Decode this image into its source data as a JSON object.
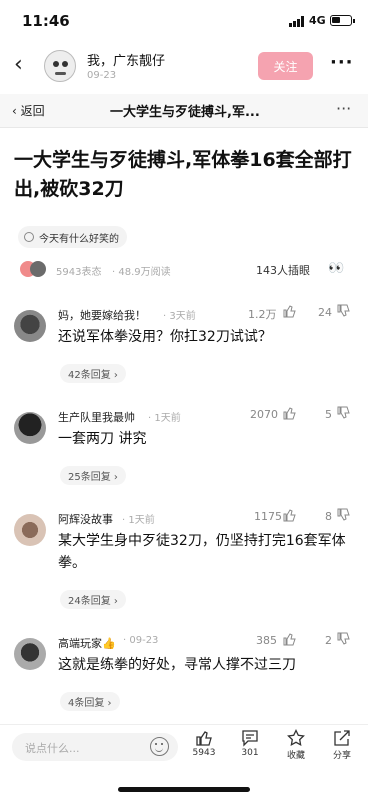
{
  "status": {
    "time": "11:46",
    "network": "4G"
  },
  "appbar": {
    "author": "我，广东靓仔",
    "date": "09-23",
    "follow": "关注"
  },
  "navbar": {
    "back": "返回",
    "title": "一大学生与歹徒搏斗,军..."
  },
  "article": {
    "headline": "一大学生与歹徒搏斗,军体拳16套全部打出,被砍32刀",
    "topic": "今天有什么好笑的",
    "reactions": "5943表态",
    "reads": "48.9万阅读",
    "inserts": "143人插眼"
  },
  "comments": [
    {
      "user": "妈，她要嫁给我！",
      "time": "3天前",
      "likes": "1.2万",
      "dislikes": "24",
      "text": "还说军体拳没用？你扛32刀试试？",
      "replies": "42条回复 ›"
    },
    {
      "user": "生产队里我最帅",
      "time": "1天前",
      "likes": "2070",
      "dislikes": "5",
      "text": "一套两刀 讲究",
      "replies": "25条回复 ›"
    },
    {
      "user": "阿辉没故事",
      "time": "1天前",
      "likes": "1175",
      "dislikes": "8",
      "text": "某大学生身中歹徒32刀，仍坚持打完16套军体拳。",
      "replies": "24条回复 ›"
    },
    {
      "user": "高端玩家👍",
      "time": "09-23",
      "likes": "385",
      "dislikes": "2",
      "text": "这就是练拳的好处，寻常人撑不过三刀",
      "replies": "4条回复 ›"
    }
  ],
  "bottom": {
    "placeholder": "说点什么...",
    "likes": "5943",
    "comments": "301",
    "collect": "收藏",
    "share": "分享"
  },
  "colors": {
    "follow_bg": "#f5a3b0",
    "accent": "#111111"
  }
}
